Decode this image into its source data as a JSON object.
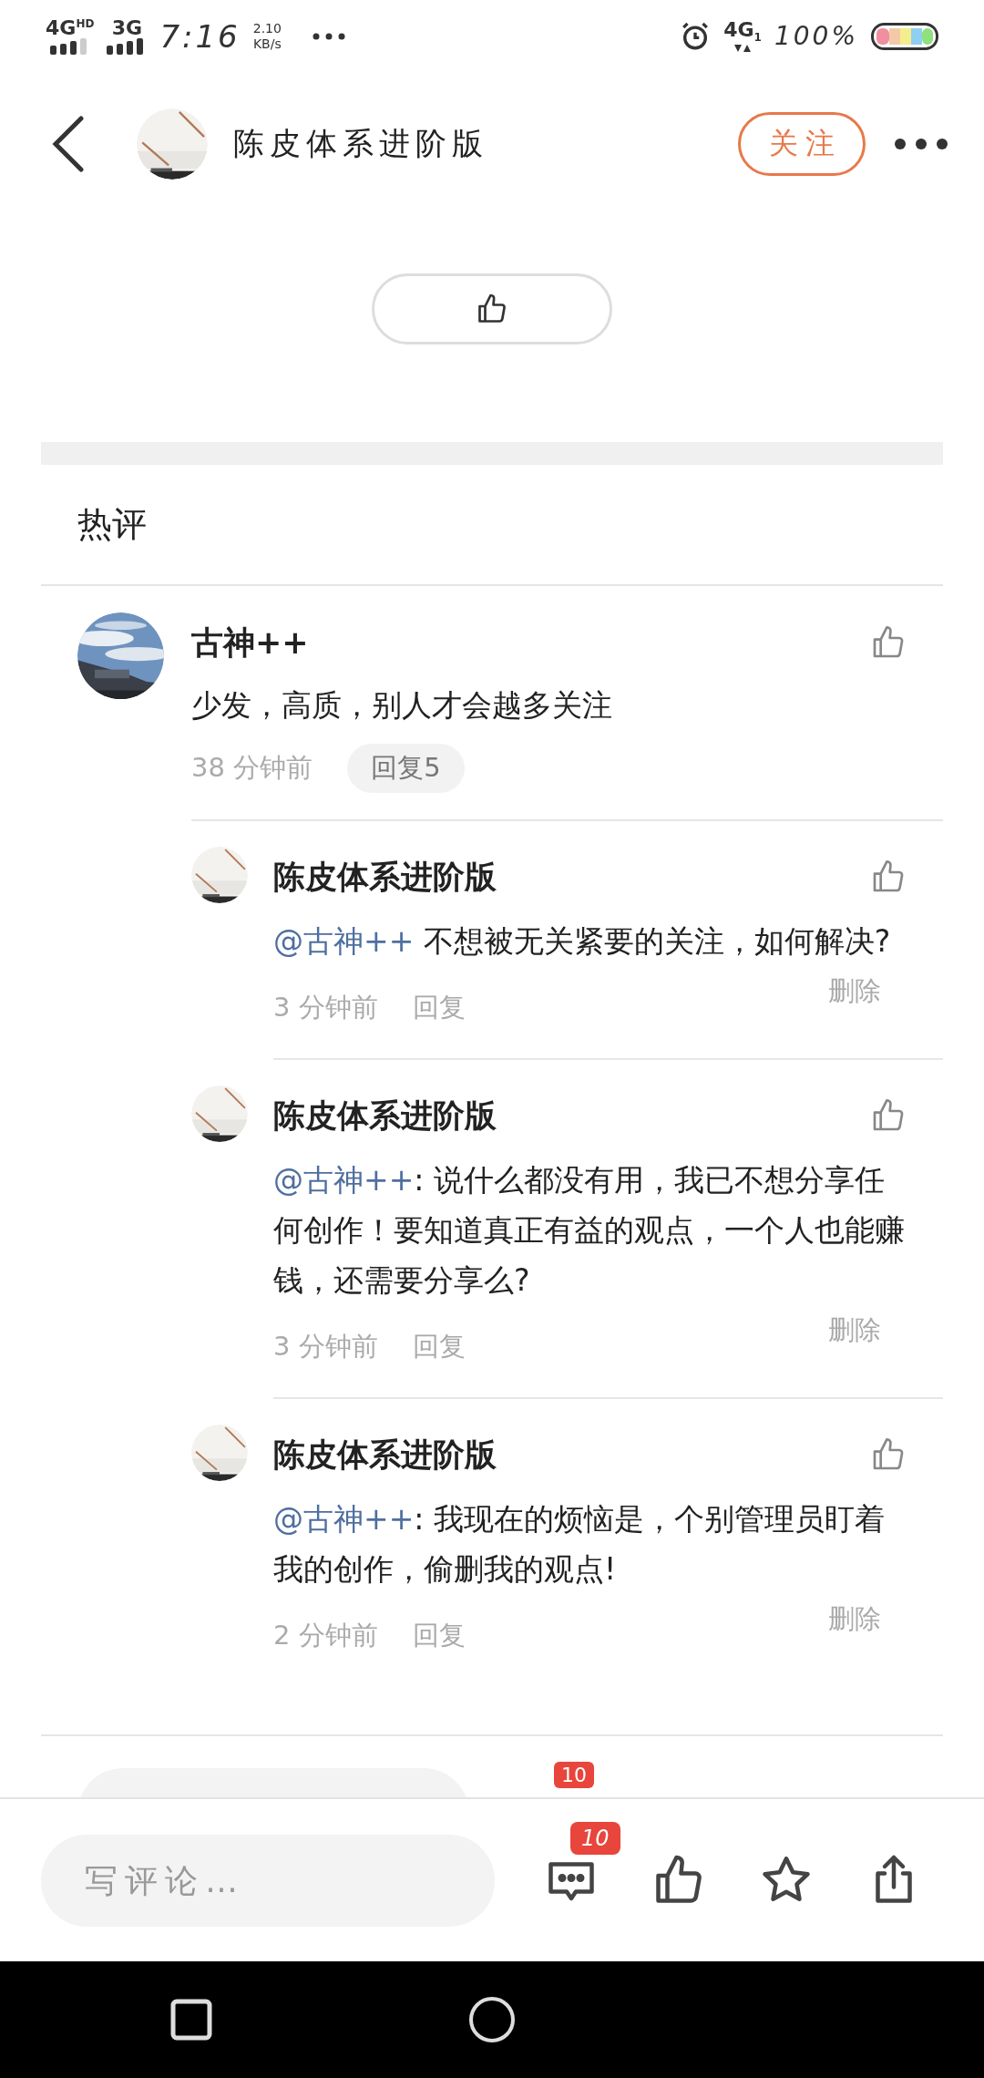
{
  "status_bar": {
    "network_1": "4G$^{HD}$",
    "network_2": "3G",
    "time": "7:16",
    "speed": "2.10",
    "speed_unit": "KB/s",
    "network_3": "4G$_{1}$",
    "battery": "100%"
  },
  "header": {
    "title": "陈皮体系进阶版",
    "follow_button": "关注"
  },
  "hot_comments": {
    "heading": "热评",
    "comments": [
      {
        "author": "古神++",
        "text": "少发，高质，别人才会越多关注",
        "time": "38 分钟前",
        "reply_button": "回复5",
        "replies": [
          {
            "author": "陈皮体系进阶版",
            "mention": "@古神++",
            "text": " 不想被无关紧要的关注，如何解决?",
            "time": "3 分钟前",
            "reply": "回复",
            "delete": "删除"
          },
          {
            "author": "陈皮体系进阶版",
            "mention": "@古神++",
            "text": ": 说什么都没有用，我已不想分享任何创作！要知道真正有益的观点，一个人也能赚钱，还需要分享么?",
            "time": "3 分钟前",
            "reply": "回复",
            "delete": "删除"
          },
          {
            "author": "陈皮体系进阶版",
            "mention": "@古神++",
            "text": ": 我现在的烦恼是，个别管理员盯着我的创作，偷删我的观点!",
            "time": "2 分钟前",
            "reply": "回复",
            "delete": "删除"
          }
        ]
      }
    ]
  },
  "ghost_bar": {
    "comment_count": "10"
  },
  "bottom_bar": {
    "placeholder": "写评论…",
    "comment_count": "10"
  }
}
